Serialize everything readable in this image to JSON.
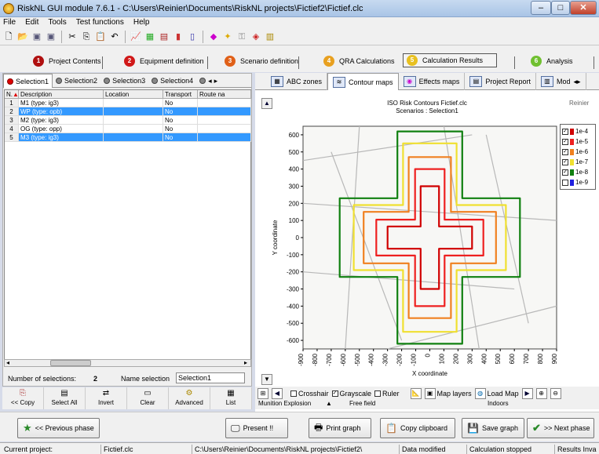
{
  "window": {
    "title": "RiskNL GUI module 7.6.1  -  C:\\Users\\Reinier\\Documents\\RiskNL projects\\Fictief2\\Fictief.clc"
  },
  "menu": [
    "File",
    "Edit",
    "Tools",
    "Test functions",
    "Help"
  ],
  "phases": [
    {
      "num": "1",
      "label": "Project Contents",
      "color": "#b01010"
    },
    {
      "num": "2",
      "label": "Equipment definition",
      "color": "#d01818"
    },
    {
      "num": "3",
      "label": "Scenario definition",
      "color": "#e06018"
    },
    {
      "num": "4",
      "label": "QRA Calculations",
      "color": "#e8a020"
    },
    {
      "num": "5",
      "label": "Calculation Results",
      "color": "#e8c020"
    },
    {
      "num": "6",
      "label": "Analysis",
      "color": "#70c030"
    }
  ],
  "selection_tabs": [
    "Selection1",
    "Selection2",
    "Selection3",
    "Selection4"
  ],
  "table": {
    "columns": [
      "N.",
      "Description",
      "Location",
      "Transport",
      "Route na"
    ],
    "rows": [
      {
        "n": "1",
        "description": "M1 (type: ig3)",
        "location": "",
        "transport": "No",
        "route": "",
        "selected": false
      },
      {
        "n": "2",
        "description": "WP (type: opb)",
        "location": "",
        "transport": "No",
        "route": "",
        "selected": true
      },
      {
        "n": "3",
        "description": "M2 (type: ig3)",
        "location": "",
        "transport": "No",
        "route": "",
        "selected": false
      },
      {
        "n": "4",
        "description": "OG (type: opp)",
        "location": "",
        "transport": "No",
        "route": "",
        "selected": false
      },
      {
        "n": "5",
        "description": "M3 (type: ig3)",
        "location": "",
        "transport": "No",
        "route": "",
        "selected": true
      }
    ]
  },
  "selection_info": {
    "count_label": "Number of selections:",
    "count": "2",
    "name_label": "Name selection",
    "name_value": "Selection1"
  },
  "left_buttons": [
    "<< Copy",
    "Select All",
    "Invert",
    "Clear",
    "Advanced",
    "List"
  ],
  "result_tabs": [
    "ABC zones",
    "Contour maps",
    "Effects maps",
    "Project Report",
    "Mod"
  ],
  "chart_header": {
    "title": "ISO Risk Contours  Fictief.clc",
    "subtitle": "Scenarios : Selection1",
    "user": "Reinier"
  },
  "chart_data": {
    "type": "line",
    "xlabel": "X coordinate",
    "ylabel": "Y coordinate",
    "xlim": [
      -900,
      900
    ],
    "ylim": [
      -650,
      650
    ],
    "x_ticks": [
      -900,
      -800,
      -700,
      -600,
      -500,
      -400,
      -300,
      -200,
      -100,
      0,
      100,
      200,
      300,
      400,
      500,
      600,
      700,
      800,
      900
    ],
    "y_ticks": [
      600,
      500,
      400,
      300,
      200,
      100,
      0,
      -100,
      -200,
      -300,
      -400,
      -500,
      -600
    ],
    "center": [
      0,
      0
    ],
    "legend": [
      {
        "label": "1e-4",
        "color": "#d00000",
        "checked": true
      },
      {
        "label": "1e-5",
        "color": "#ee2020",
        "checked": true
      },
      {
        "label": "1e-6",
        "color": "#f08020",
        "checked": true
      },
      {
        "label": "1e-7",
        "color": "#f0e030",
        "checked": true
      },
      {
        "label": "1e-8",
        "color": "#108010",
        "checked": true
      },
      {
        "label": "1e-9",
        "color": "#2020e0",
        "checked": false
      }
    ],
    "contours": [
      {
        "level": "1e-8",
        "color": "#108010",
        "arm_x": 640,
        "arm_y": 620,
        "width": 230
      },
      {
        "level": "1e-7",
        "color": "#f0e030",
        "arm_x": 540,
        "arm_y": 550,
        "width": 190
      },
      {
        "level": "1e-6",
        "color": "#f08020",
        "arm_x": 470,
        "arm_y": 470,
        "width": 150
      },
      {
        "level": "1e-5",
        "color": "#ee2020",
        "arm_x": 380,
        "arm_y": 400,
        "width": 105
      },
      {
        "level": "1e-4",
        "color": "#d00000",
        "arm_x": 300,
        "arm_y": 300,
        "width": 65
      }
    ]
  },
  "map_controls": {
    "crosshair": "Crosshair",
    "grayscale": "Grayscale",
    "ruler": "Ruler",
    "map_layers": "Map layers",
    "load_map": "Load Map"
  },
  "status_line": {
    "left": "Munition Explosion",
    "mid": "Free field",
    "right": "Indoors"
  },
  "bottom_buttons": {
    "prev": "<< Previous phase",
    "present": "Present !!",
    "print": "Print graph",
    "copy": "Copy clipboard",
    "save": "Save graph",
    "next": ">> Next phase"
  },
  "status_bar": [
    "Current project:",
    "Fictief.clc",
    "C:\\Users\\Reinier\\Documents\\RiskNL projects\\Fictief2\\",
    "Data modified",
    "Calculation stopped",
    "Results Inva"
  ]
}
